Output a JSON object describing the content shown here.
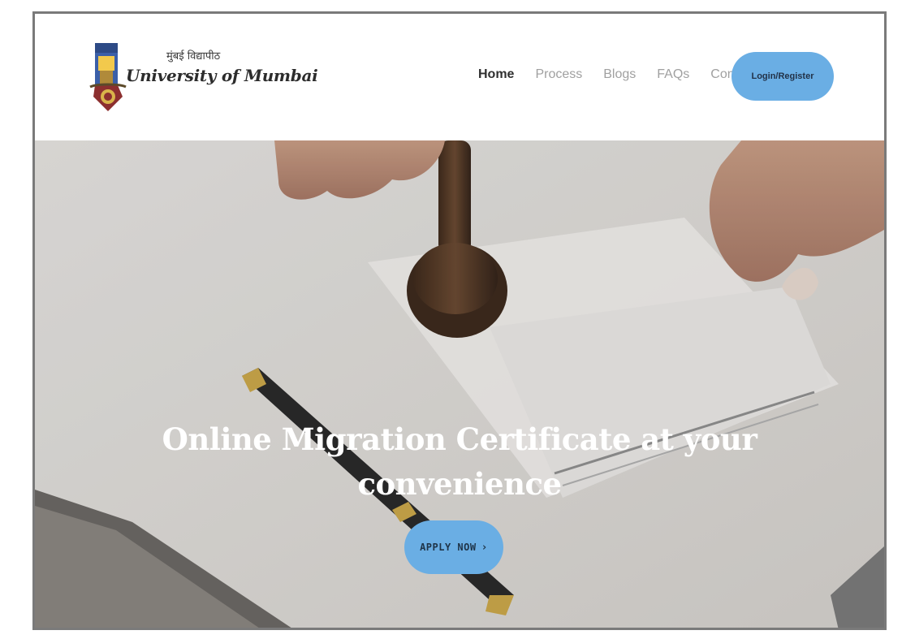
{
  "colors": {
    "accent": "#6aaee4",
    "nav_active": "#2f2f2f",
    "nav_inactive": "#a0a0a0",
    "hero_text": "#ffffff"
  },
  "header": {
    "logo": {
      "hindi_text": "मुंबई विद्यापीठ",
      "name": "University of Mumbai",
      "icon": "university-crest-icon"
    },
    "nav": [
      {
        "label": "Home",
        "active": true
      },
      {
        "label": "Process",
        "active": false
      },
      {
        "label": "Blogs",
        "active": false
      },
      {
        "label": "FAQs",
        "active": false
      },
      {
        "label": "Contact",
        "active": false
      }
    ],
    "login_label": "Login/Register"
  },
  "hero": {
    "title_line1": "Online Migration Certificate at your",
    "title_line2": "convenience",
    "apply_label": "APPLY NOW",
    "apply_icon": "chevron-right-icon",
    "apply_glyph": "›"
  }
}
